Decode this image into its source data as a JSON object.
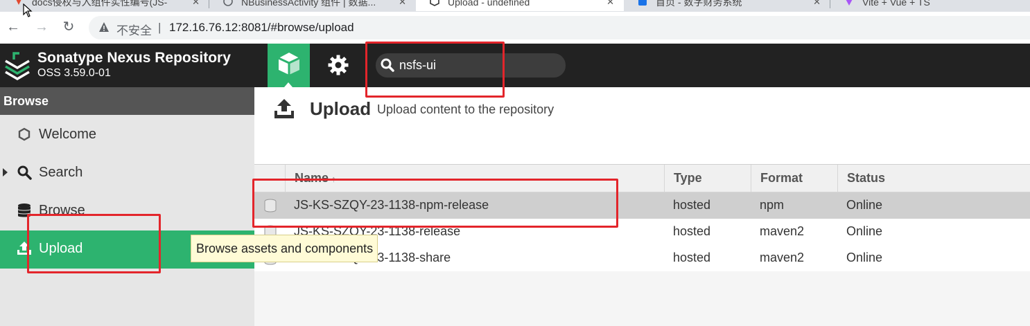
{
  "browser": {
    "tabs": [
      {
        "label": "docs侵权与入组件实性编号(JS-"
      },
      {
        "label": "NBusinessActivity 组件 | 数据..."
      },
      {
        "label": "Upload - undefined"
      },
      {
        "label": "首页 - 数字财务系统"
      },
      {
        "label": "Vite + Vue + TS"
      }
    ],
    "insecure_label": "不安全",
    "url": "172.16.76.12:8081/#browse/upload"
  },
  "header": {
    "title": "Sonatype Nexus Repository",
    "version": "OSS 3.59.0-01",
    "search_value": "nsfs-ui"
  },
  "sidebar": {
    "heading": "Browse",
    "items": [
      {
        "label": "Welcome",
        "icon": "hexagon-icon"
      },
      {
        "label": "Search",
        "icon": "magnifier-icon"
      },
      {
        "label": "Browse",
        "icon": "database-icon"
      },
      {
        "label": "Upload",
        "icon": "upload-icon"
      }
    ]
  },
  "page": {
    "title": "Upload",
    "subtitle": "Upload content to the repository"
  },
  "grid": {
    "columns": [
      "Name",
      "Type",
      "Format",
      "Status"
    ],
    "sort_indicator": "↑",
    "rows": [
      {
        "name": "JS-KS-SZQY-23-1138-npm-release",
        "type": "hosted",
        "format": "npm",
        "status": "Online"
      },
      {
        "name": "JS-KS-SZQY-23-1138-release",
        "type": "hosted",
        "format": "maven2",
        "status": "Online"
      },
      {
        "name": "JS-KS-SZQY-23-1138-share",
        "type": "hosted",
        "format": "maven2",
        "status": "Online"
      }
    ]
  },
  "tooltip": "Browse assets and components",
  "colors": {
    "accent_green": "#2db36f",
    "header_dark": "#222222",
    "annotation_red": "#e3252b"
  }
}
